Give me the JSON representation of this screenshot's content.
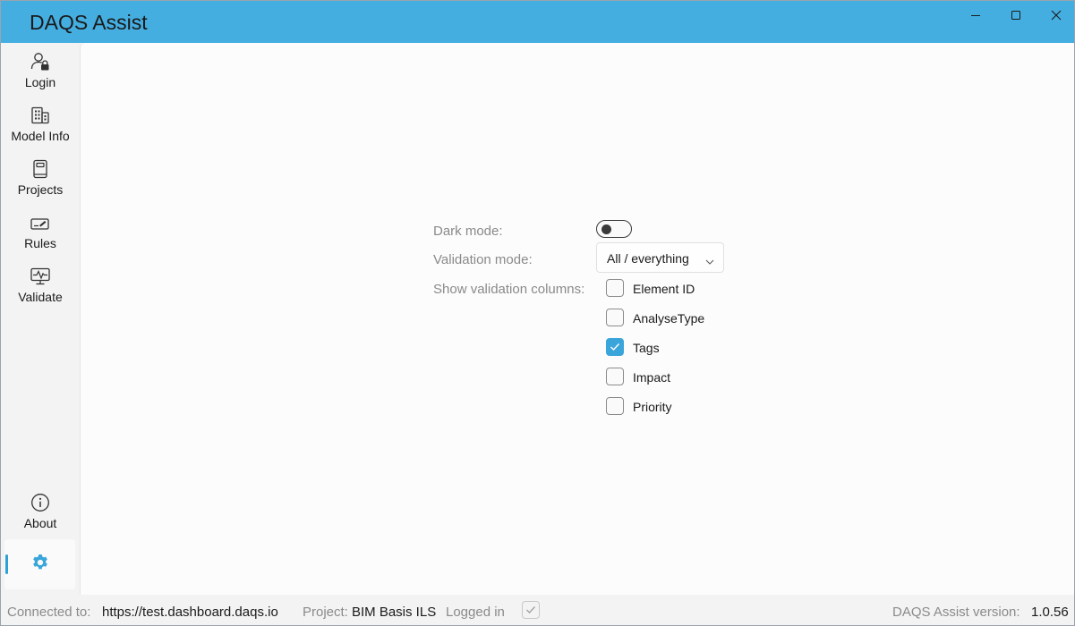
{
  "window": {
    "title": "DAQS Assist",
    "accent_color": "#45aee0",
    "controls": [
      "minimize-icon",
      "maximize-icon",
      "close-icon"
    ]
  },
  "sidebar": {
    "items": [
      {
        "label": "Login",
        "icon": "user-lock-icon"
      },
      {
        "label": "Model Info",
        "icon": "building-icon"
      },
      {
        "label": "Projects",
        "icon": "notebook-icon"
      },
      {
        "label": "Rules",
        "icon": "ruler-signature-icon"
      },
      {
        "label": "Validate",
        "icon": "monitor-pulse-icon"
      },
      {
        "label": "About",
        "icon": "info-icon"
      }
    ],
    "selected": {
      "label": "",
      "icon": "gear-icon"
    }
  },
  "settings": {
    "dark_mode_label": "Dark mode:",
    "dark_mode_on": false,
    "validation_mode_label": "Validation mode:",
    "validation_mode_value": "All / everything",
    "columns_label": "Show validation columns:",
    "columns": [
      {
        "label": "Element ID",
        "checked": false
      },
      {
        "label": "AnalyseType",
        "checked": false
      },
      {
        "label": "Tags",
        "checked": true
      },
      {
        "label": "Impact",
        "checked": false
      },
      {
        "label": "Priority",
        "checked": false
      }
    ],
    "checkbox_checked_color": "#3aa5da"
  },
  "statusbar": {
    "connected_label": "Connected to:",
    "connected_url": "https://test.dashboard.daqs.io",
    "project_label": "Project:",
    "project_name": "BIM Basis ILS",
    "logged_in_label": "Logged in",
    "logged_in": true,
    "version_label": "DAQS Assist version:",
    "version": "1.0.56"
  }
}
